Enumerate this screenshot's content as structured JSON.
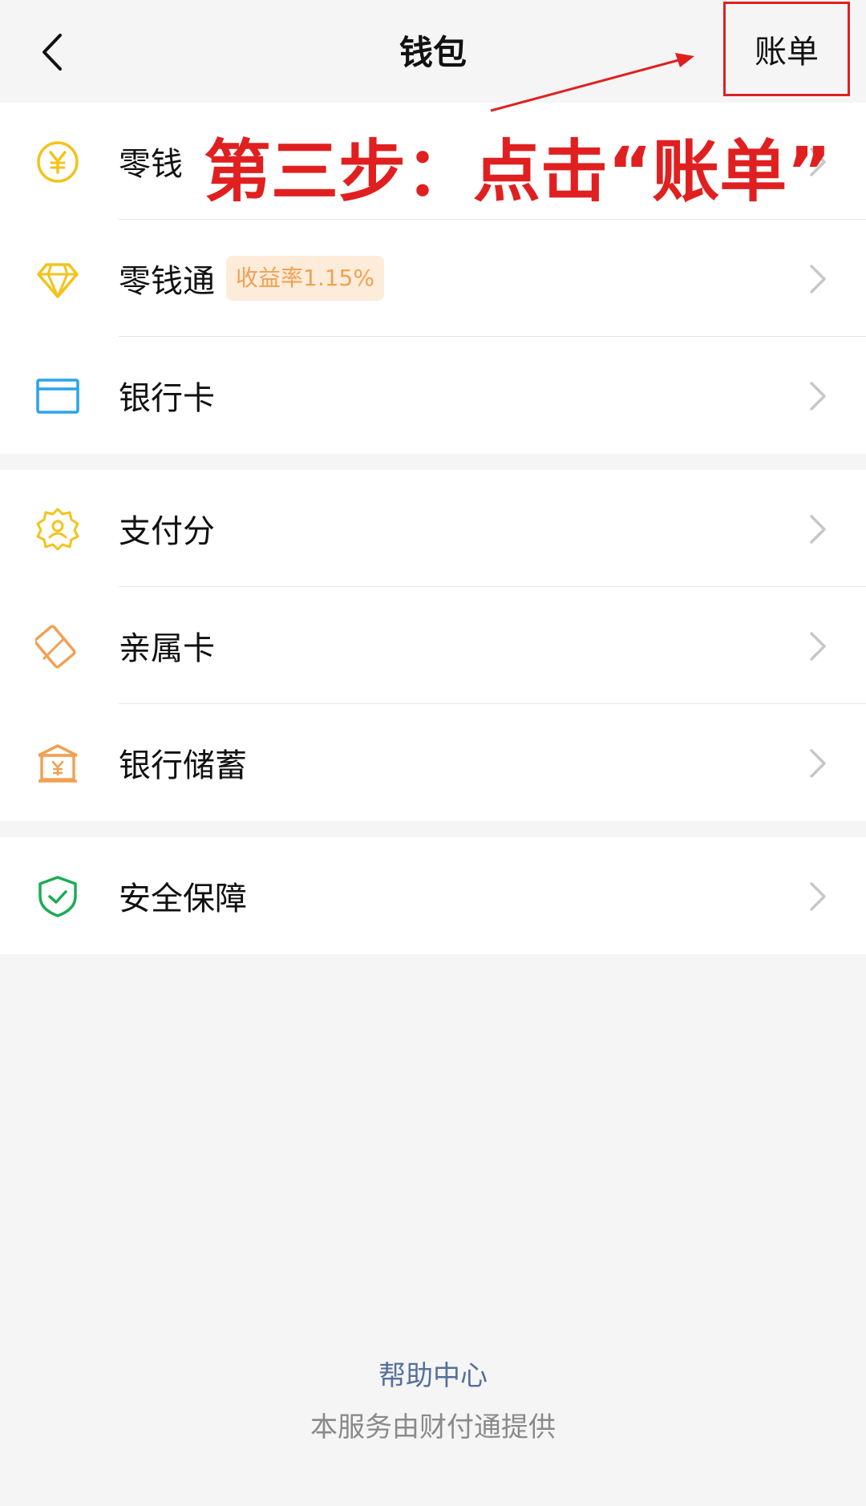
{
  "header": {
    "title": "钱包",
    "bill_label": "账单"
  },
  "sections": [
    {
      "items": [
        {
          "label": "零钱",
          "icon": "coin-yuan-icon"
        },
        {
          "label": "零钱通",
          "icon": "diamond-icon",
          "badge": "收益率1.15%"
        },
        {
          "label": "银行卡",
          "icon": "bank-card-icon"
        }
      ]
    },
    {
      "items": [
        {
          "label": "支付分",
          "icon": "pay-score-icon"
        },
        {
          "label": "亲属卡",
          "icon": "family-card-icon"
        },
        {
          "label": "银行储蓄",
          "icon": "bank-savings-icon"
        }
      ]
    },
    {
      "items": [
        {
          "label": "安全保障",
          "icon": "security-shield-icon"
        }
      ]
    }
  ],
  "footer": {
    "help": "帮助中心",
    "provider": "本服务由财付通提供"
  },
  "annotation": {
    "text": "第三步：点击“账单”"
  },
  "colors": {
    "background": "#f5f5f5",
    "yellow_icon": "#f3c31b",
    "blue_icon": "#2aa4e8",
    "orange_icon": "#f0a154",
    "green_icon": "#1aad52",
    "annotation_red": "#e02020",
    "help_link": "#56709a"
  }
}
